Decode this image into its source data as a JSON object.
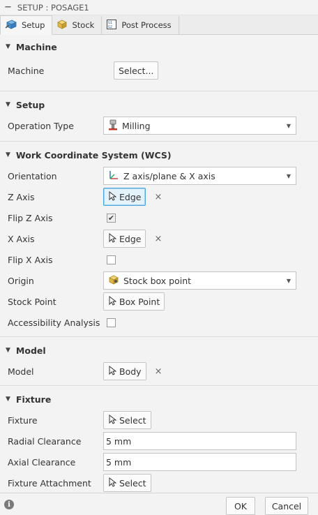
{
  "window": {
    "title": "SETUP : POSAGE1"
  },
  "tabs": [
    {
      "label": "Setup",
      "icon": "setup-icon",
      "active": true
    },
    {
      "label": "Stock",
      "icon": "stock-icon",
      "active": false
    },
    {
      "label": "Post Process",
      "icon": "post-process-icon",
      "active": false
    }
  ],
  "machine": {
    "header": "Machine",
    "machine_label": "Machine",
    "select_label": "Select..."
  },
  "setup": {
    "header": "Setup",
    "operation_type_label": "Operation Type",
    "operation_type_value": "Milling"
  },
  "wcs": {
    "header": "Work Coordinate System (WCS)",
    "orientation_label": "Orientation",
    "orientation_value": "Z axis/plane & X axis",
    "z_axis_label": "Z Axis",
    "z_axis_value": "Edge",
    "flip_z_label": "Flip Z Axis",
    "flip_z_checked": true,
    "x_axis_label": "X Axis",
    "x_axis_value": "Edge",
    "flip_x_label": "Flip X Axis",
    "flip_x_checked": false,
    "origin_label": "Origin",
    "origin_value": "Stock box point",
    "stock_point_label": "Stock Point",
    "stock_point_value": "Box Point",
    "accessibility_label": "Accessibility Analysis",
    "accessibility_checked": false
  },
  "model": {
    "header": "Model",
    "model_label": "Model",
    "model_value": "Body"
  },
  "fixture": {
    "header": "Fixture",
    "fixture_label": "Fixture",
    "fixture_value": "Select",
    "radial_label": "Radial Clearance",
    "radial_value": "5 mm",
    "axial_label": "Axial Clearance",
    "axial_value": "5 mm",
    "attachment_label": "Fixture Attachment",
    "attachment_value": "Select"
  },
  "footer": {
    "ok_label": "OK",
    "cancel_label": "Cancel"
  },
  "glyphs": {
    "collapse": "−",
    "triangle": "▼",
    "caret": "▼",
    "check": "✔",
    "clear": "×",
    "info": "i"
  },
  "colors": {
    "accent": "#4fa6d9",
    "selected_bg": "#e4f2fb",
    "panel_bg": "#f3f3f3"
  }
}
